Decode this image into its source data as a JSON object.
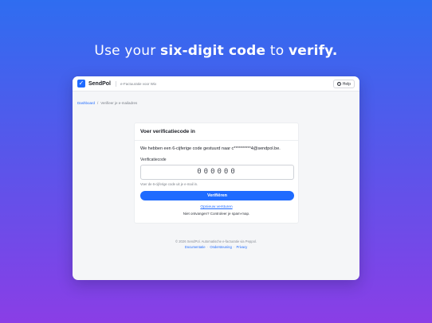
{
  "headline": {
    "prefix": "Use your ",
    "emphasis1": "six-digit code",
    "middle": " to ",
    "emphasis2": "verify."
  },
  "app": {
    "brand": "SendPol",
    "tagline": "e-Factuuratie voor Wix",
    "help_label": "Help",
    "logo_icon": "check-icon"
  },
  "breadcrumb": {
    "home": "Dashboard",
    "separator": "/",
    "current": "Verifieer je e-mailadres"
  },
  "card": {
    "title": "Voer verificatiecode in",
    "info": "We hebben een 6-cijferige code gestuurd naar c**********4@sendpol.be.",
    "field_label": "Verificatiecode",
    "code_value": "000000",
    "hint": "Voer de 6-cijferige code uit je e-mail in.",
    "verify_label": "Verifiëren",
    "resend_label": "Opnieuw versturen",
    "no_code": "Niet ontvangen? Controleer je spam-map."
  },
  "footer": {
    "copyright": "© 2026 SendPol. Automatische e-facturatie via Peppol.",
    "links": [
      "Documentatie",
      "Ondersteuning",
      "Privacy"
    ],
    "link_separator": "·"
  },
  "colors": {
    "accent": "#1f6bff",
    "gradient_top": "#2f6df0",
    "gradient_bottom": "#8a3ee6"
  }
}
